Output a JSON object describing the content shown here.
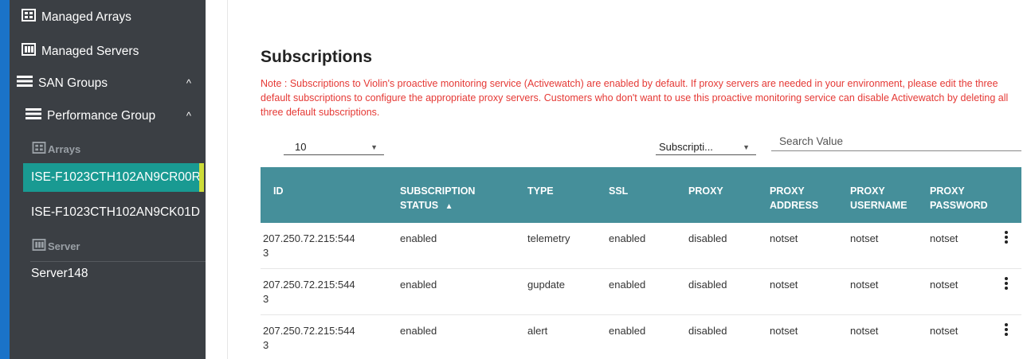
{
  "sidebar": {
    "managed_arrays": "Managed Arrays",
    "managed_servers": "Managed Servers",
    "san_groups": "SAN Groups",
    "performance_group": "Performance Group",
    "arrays_header": "Arrays",
    "array_items": [
      "ISE-F1023CTH102AN9CR00R",
      "ISE-F1023CTH102AN9CK01D"
    ],
    "server_header": "Server",
    "server_items": [
      "Server148"
    ],
    "chevron": "^"
  },
  "page": {
    "title": "Subscriptions",
    "note": "Note : Subscriptions to Violin's proactive monitoring service (Activewatch) are enabled by default. If proxy servers are needed in your environment, please edit the three default subscriptions to configure the appropriate proxy servers. Customers who don't want to use this proactive monitoring service can disable Activewatch by deleting all three default subscriptions."
  },
  "controls": {
    "page_size": "10",
    "filter_field": "Subscripti...",
    "search_placeholder": "Search Value"
  },
  "table": {
    "headers": {
      "id": "ID",
      "status_line1": "SUBSCRIPTION",
      "status_line2": "STATUS",
      "sort_indicator": "▲",
      "type": "TYPE",
      "ssl": "SSL",
      "proxy": "PROXY",
      "proxy_address_1": "PROXY",
      "proxy_address_2": "ADDRESS",
      "proxy_username_1": "PROXY",
      "proxy_username_2": "USERNAME",
      "proxy_password_1": "PROXY",
      "proxy_password_2": "PASSWORD"
    },
    "rows": [
      {
        "id_1": "207.250.72.215:544",
        "id_2": "3",
        "status": "enabled",
        "type": "telemetry",
        "ssl": "enabled",
        "proxy": "disabled",
        "address": "notset",
        "username": "notset",
        "password": "notset"
      },
      {
        "id_1": "207.250.72.215:544",
        "id_2": "3",
        "status": "enabled",
        "type": "gupdate",
        "ssl": "enabled",
        "proxy": "disabled",
        "address": "notset",
        "username": "notset",
        "password": "notset"
      },
      {
        "id_1": "207.250.72.215:544",
        "id_2": "3",
        "status": "enabled",
        "type": "alert",
        "ssl": "enabled",
        "proxy": "disabled",
        "address": "notset",
        "username": "notset",
        "password": "notset"
      }
    ]
  },
  "colors": {
    "sidebar_bg": "#3b3f44",
    "accent_blue": "#1a73c8",
    "selected_teal": "#199a92",
    "selected_marker": "#cddc39",
    "table_header": "#458f9a",
    "note_red": "#e53935"
  }
}
